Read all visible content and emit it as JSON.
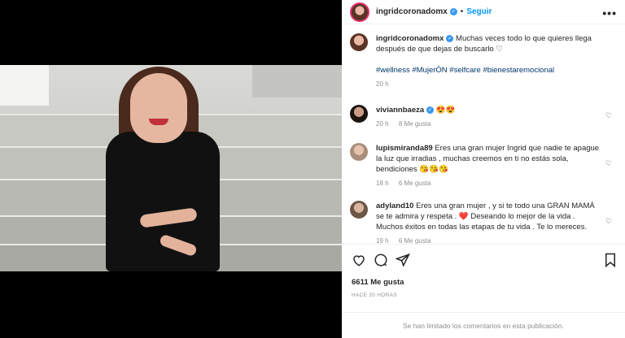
{
  "post": {
    "username": "ingridcoronadomx",
    "follow_label": "Seguir",
    "more_label": "•••",
    "caption_line1": "Muchas veces todo lo que quieres llega",
    "caption_line2": "después de que dejas de buscarlo ♡",
    "hashtags": "#wellness #MujerÓN #selfcare #bienestaremocional",
    "caption_time": "20 h"
  },
  "comments": [
    {
      "user": "viviannbaeza",
      "text": "😍😍",
      "time": "20 h",
      "likes": "8 Me gusta"
    },
    {
      "user": "lupismiranda89",
      "text": "Eres una gran mujer Ingrid que nadie te apague la luz que irradias , muchas creemos en ti no estás sola, bendiciones 😘😘😘",
      "time": "18 h",
      "likes": "6 Me gusta"
    },
    {
      "user": "adyland10",
      "text": "Eres una gran mujer , y si te todo una GRAN MAMÁ se te admira y respeta . ❤️ Deseando lo mejor de la vida . Muchos éxitos en todas las etapas de tu vida . Te lo mereces.",
      "time": "19 h",
      "likes": "6 Me gusta"
    }
  ],
  "actions": {
    "like_icon": "heart-icon",
    "comment_icon": "comment-icon",
    "share_icon": "share-icon",
    "save_icon": "bookmark-icon",
    "likes_count": "6611 Me gusta",
    "posted_ago": "HACE 20 HORAS"
  },
  "footer": {
    "limited_text": "Se han limitado los comentarios en esta publicación."
  },
  "colors": {
    "accent": "#0095f6",
    "verified": "#3897f0",
    "hashtag": "#00376b",
    "muted": "#8e8e8e"
  }
}
